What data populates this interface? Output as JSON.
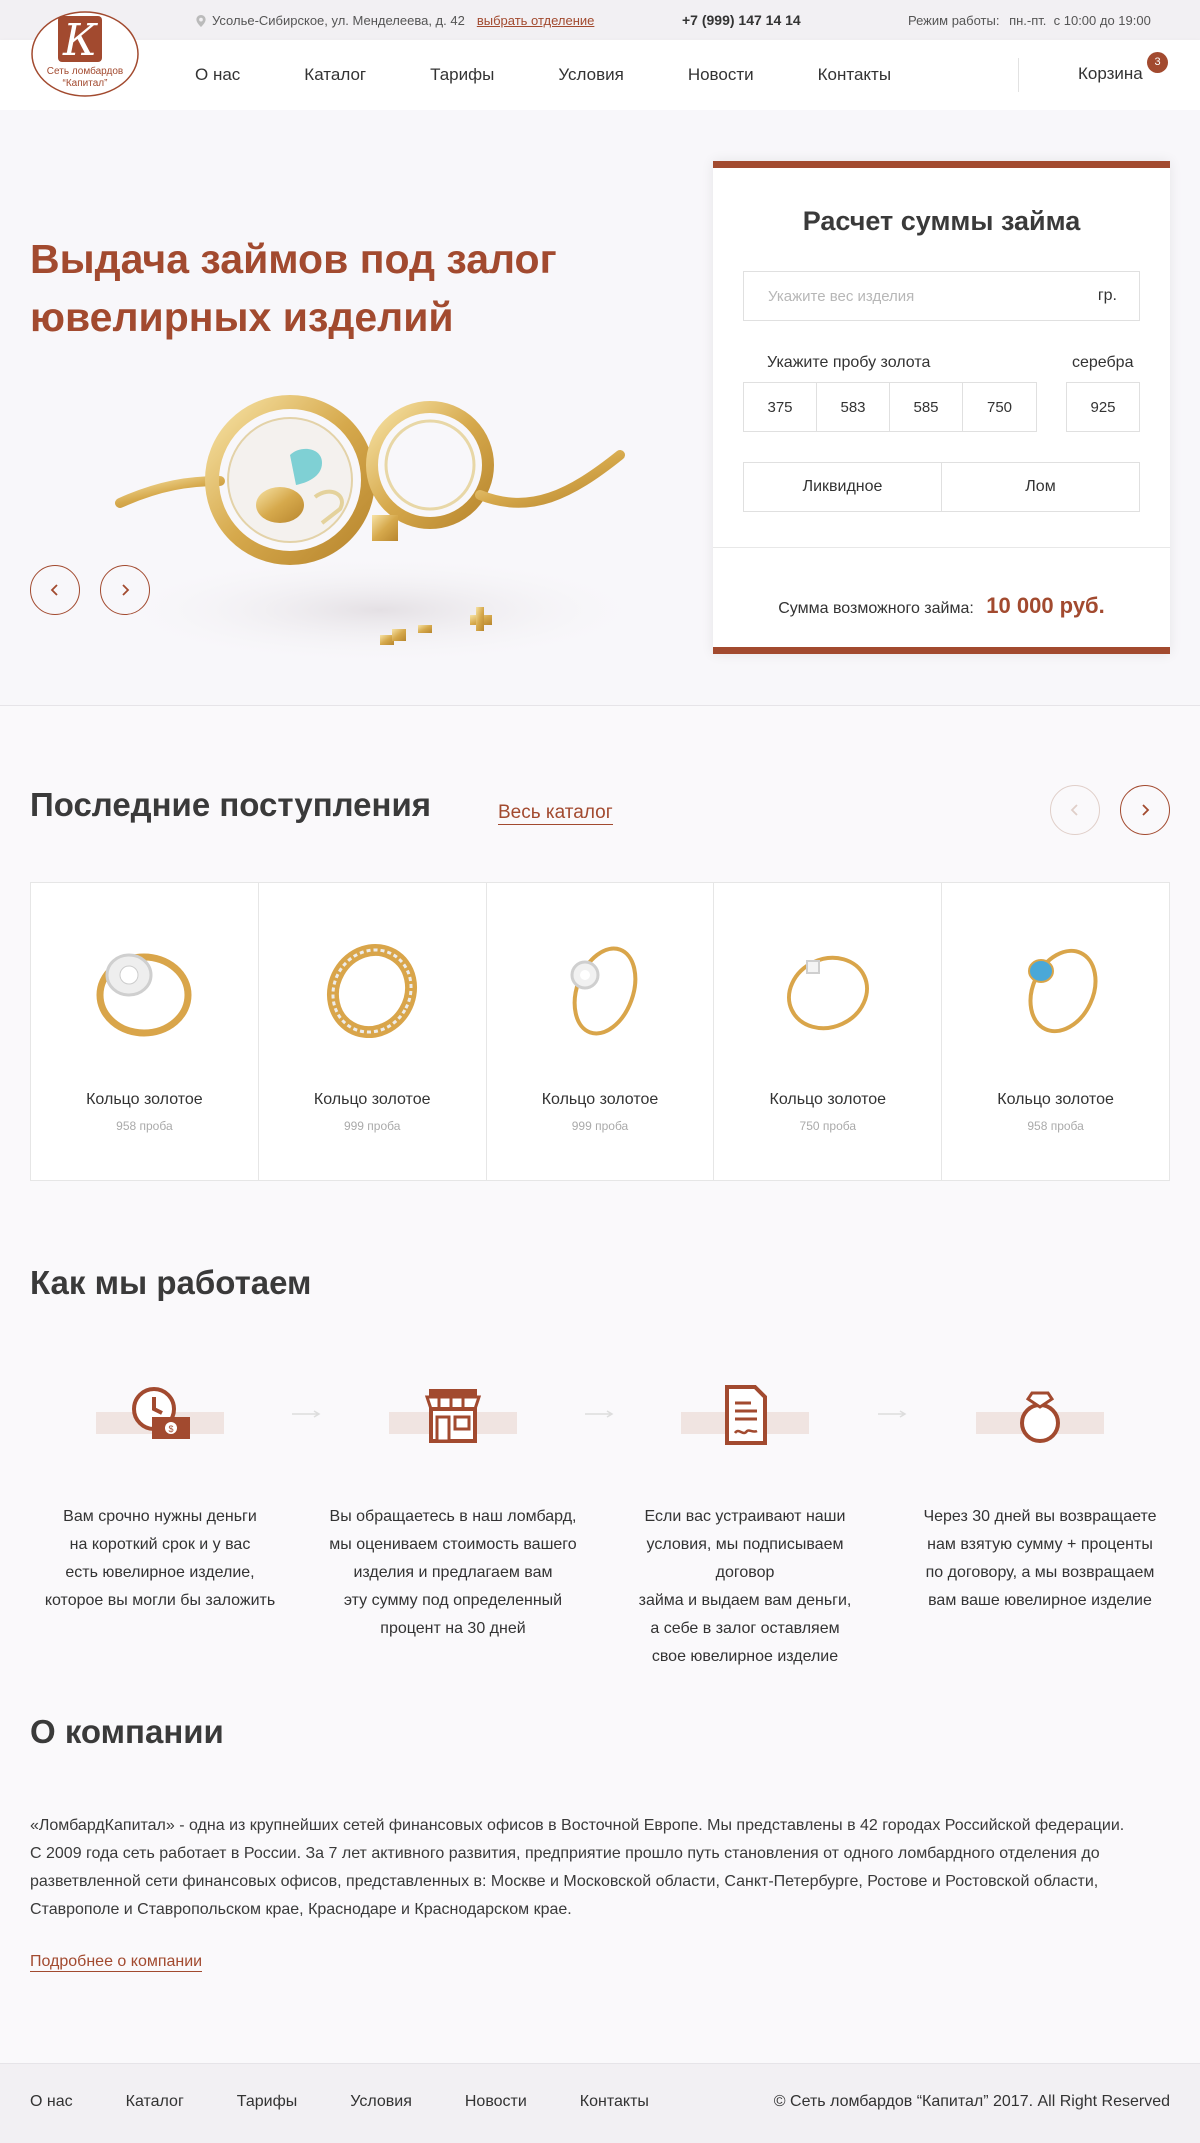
{
  "topbar": {
    "address": "Усолье-Сибирское, ул. Менделеева, д. 42",
    "branch_link": "выбрать отделение",
    "phone": "+7 (999) 147 14 14",
    "hours_label": "Режим работы:",
    "hours_value": "пн.-пт.  с 10:00 до 19:00"
  },
  "logo": {
    "letter": "К",
    "line1": "Сеть ломбардов",
    "line2": "“Капитал”"
  },
  "nav": {
    "items": [
      "О нас",
      "Каталог",
      "Тарифы",
      "Условия",
      "Новости",
      "Контакты"
    ],
    "cart_label": "Корзина",
    "cart_count": "3"
  },
  "hero": {
    "title_line1": "Выдача займов под залог",
    "title_line2": "ювелирных изделий",
    "prev_icon": "chevron-left-icon",
    "next_icon": "chevron-right-icon"
  },
  "calc": {
    "title": "Расчет суммы займа",
    "weight_placeholder": "Укажите вес изделия",
    "weight_unit": "гр.",
    "gold_label": "Укажите пробу золота",
    "silver_label": "серебра",
    "gold_probes": [
      "375",
      "583",
      "585",
      "750"
    ],
    "silver_probe": "925",
    "types": [
      "Ликвидное",
      "Лом"
    ],
    "sum_label": "Сумма возможного займа:",
    "sum_value": "10 000 руб."
  },
  "latest": {
    "title": "Последние поступления",
    "catalog_link": "Весь каталог",
    "items": [
      {
        "name": "Кольцо золотое",
        "probe": "958 проба",
        "stone": "diamond-cluster"
      },
      {
        "name": "Кольцо золотое",
        "probe": "999 проба",
        "stone": "band"
      },
      {
        "name": "Кольцо золотое",
        "probe": "999 проба",
        "stone": "flower"
      },
      {
        "name": "Кольцо золотое",
        "probe": "750 проба",
        "stone": "solitaire"
      },
      {
        "name": "Кольцо золотое",
        "probe": "958 проба",
        "stone": "topaz"
      }
    ]
  },
  "how": {
    "title": "Как мы работаем",
    "steps": [
      {
        "icon": "clock-money-icon",
        "text": "Вам срочно нужны деньги\nна короткий срок и у вас\nесть ювелирное изделие,\nкоторое вы могли бы заложить"
      },
      {
        "icon": "shop-icon",
        "text": "Вы обращаетесь в наш ломбард,\nмы оцениваем стоимость вашего\nизделия и предлагаем вам\nэту сумму под определенный\nпроцент на 30 дней"
      },
      {
        "icon": "contract-icon",
        "text": "Если вас устраивают наши\nусловия, мы подписываем договор\nзайма и выдаем вам деньги,\nа себе в залог оставляем\nсвое ювелирное изделие"
      },
      {
        "icon": "ring-icon",
        "text": "Через 30 дней вы возвращаете\nнам взятую сумму + проценты\nпо договору, а мы возвращаем\nвам ваше ювелирное изделие"
      }
    ]
  },
  "about": {
    "title": "О компании",
    "text": "«ЛомбардКапитал» - одна из крупнейших сетей финансовых офисов в Восточной Европе. Мы представлены в 42 городах Российской федерации.\nС 2009 года сеть работает в России. За 7 лет активного развития, предприятие прошло путь становления от одного ломбардного отделения до\nразветвленной сети финансовых офисов, представленных в: Москве и Московской области, Санкт-Петербурге, Ростове и Ростовской области,\nСтаврополе и Ставропольском крае, Краснодаре и Краснодарском крае.",
    "link": "Подробнее о компании"
  },
  "footer": {
    "items": [
      "О нас",
      "Каталог",
      "Тарифы",
      "Условия",
      "Новости",
      "Контакты"
    ],
    "copyright": "© Сеть ломбардов “Капитал” 2017. All Right Reserved"
  },
  "colors": {
    "accent": "#a24a2f",
    "accent_light": "#f0e4e1",
    "background": "#faf9fb",
    "topbar": "#f2f0f3"
  }
}
